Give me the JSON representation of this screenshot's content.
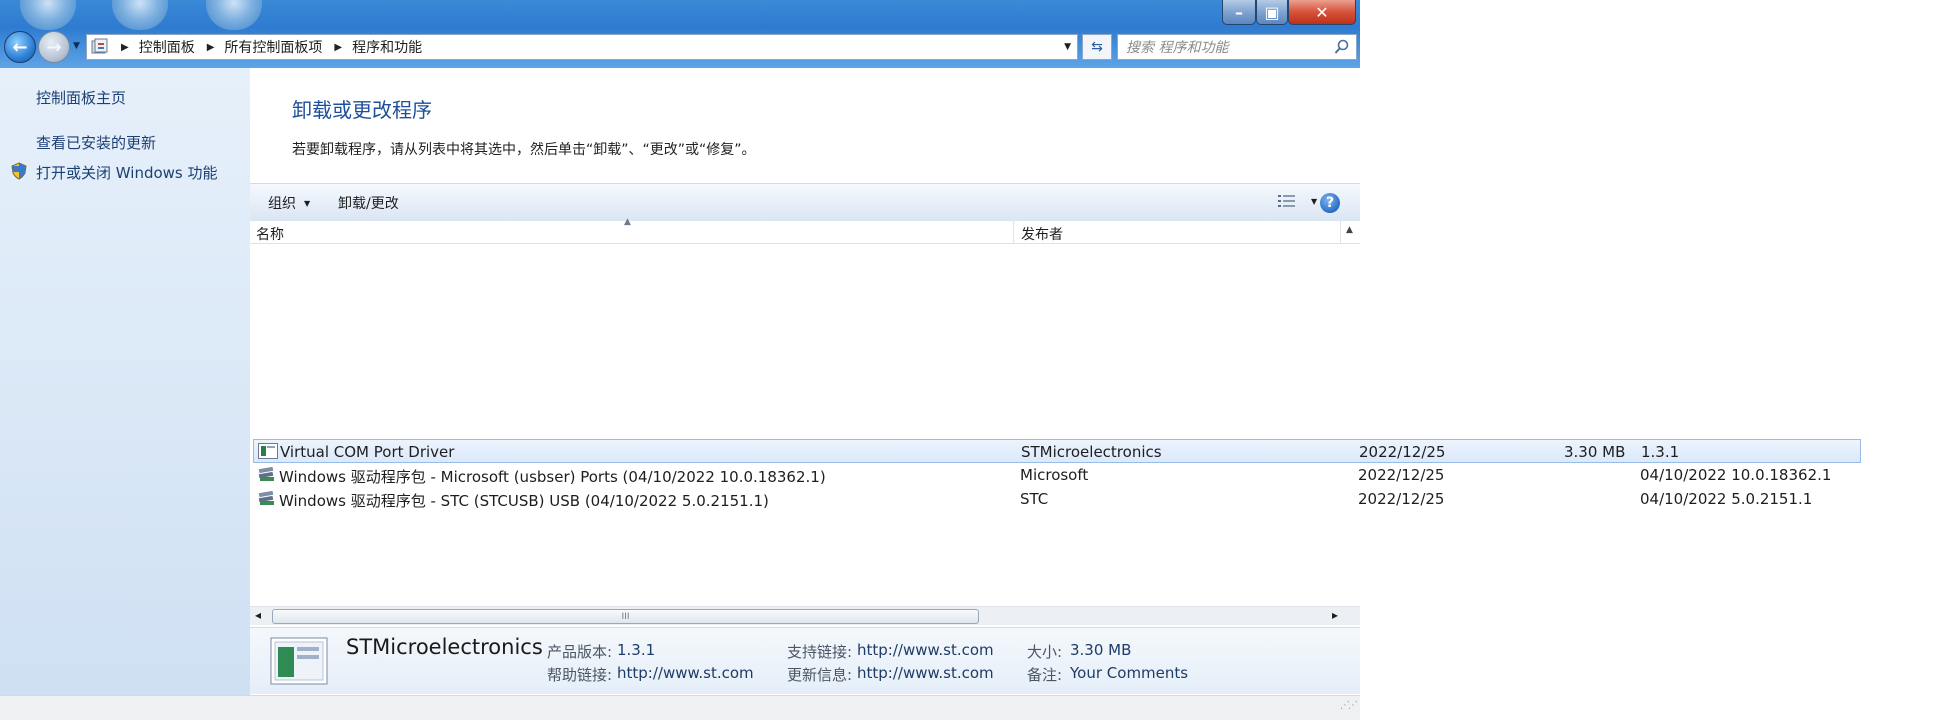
{
  "window": {
    "minimize_glyph": "–",
    "maximize_glyph": "▣",
    "close_glyph": "✕"
  },
  "nav": {
    "back_glyph": "←",
    "forward_glyph": "→",
    "breadcrumb": [
      "控制面板",
      "所有控制面板项",
      "程序和功能"
    ],
    "search_placeholder": "搜索 程序和功能"
  },
  "sidebar": {
    "items": [
      {
        "label": "控制面板主页"
      },
      {
        "label": "查看已安装的更新"
      },
      {
        "label": "打开或关闭 Windows 功能",
        "icon": "shield-icon"
      }
    ]
  },
  "main": {
    "heading": "卸载或更改程序",
    "instruction": "若要卸载程序，请从列表中将其选中，然后单击“卸载”、“更改”或“修复”。"
  },
  "toolbar": {
    "organize": "组织",
    "uninstall_change": "卸载/更改",
    "help_glyph": "?"
  },
  "table": {
    "headers": [
      "名称",
      "发布者"
    ],
    "rows": [
      {
        "name": "Virtual COM Port Driver",
        "publisher": "STMicroelectronics",
        "date": "2022/12/25",
        "size": "3.30 MB",
        "version": "1.3.1",
        "selected": true
      },
      {
        "name": "Windows 驱动程序包 - Microsoft (usbser) Ports  (04/10/2022 10.0.18362.1)",
        "publisher": "Microsoft",
        "date": "2022/12/25",
        "size": "",
        "version": "04/10/2022 10.0.18362.1",
        "selected": false
      },
      {
        "name": "Windows 驱动程序包 - STC (STCUSB) USB  (04/10/2022 5.0.2151.1)",
        "publisher": "STC",
        "date": "2022/12/25",
        "size": "",
        "version": "04/10/2022 5.0.2151.1",
        "selected": false
      }
    ]
  },
  "scrollbar": {
    "grip": "III",
    "left_arrow": "◂",
    "right_arrow": "▸"
  },
  "details": {
    "publisher": "STMicroelectronics",
    "product_version_label": "产品版本:",
    "product_version": "1.3.1",
    "help_link_label": "帮助链接:",
    "help_link": "http://www.st.com",
    "support_link_label": "支持链接:",
    "support_link": "http://www.st.com",
    "update_info_label": "更新信息:",
    "update_info": "http://www.st.com",
    "size_label": "大小:",
    "size": "3.30 MB",
    "comments_label": "备注:",
    "comments": "Your Comments"
  }
}
